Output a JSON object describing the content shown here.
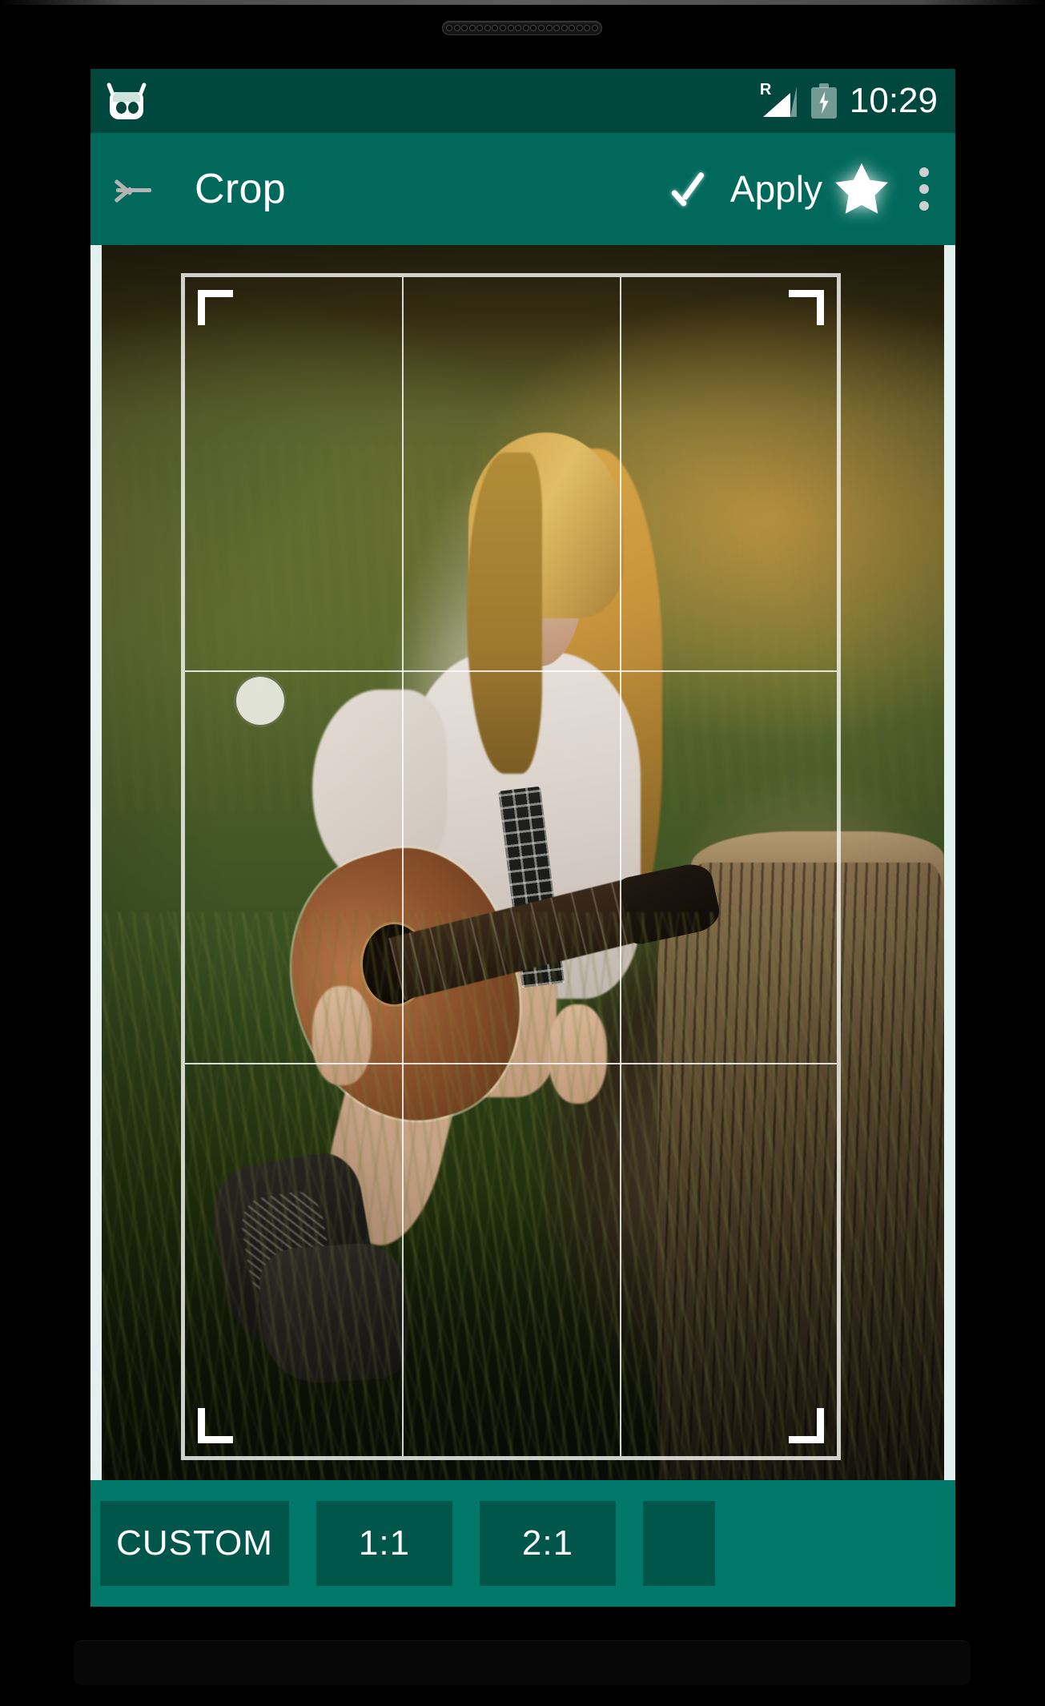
{
  "device": {
    "speaker_holes": 20
  },
  "status_bar": {
    "logo_icon": "cyanogenmod-logo-icon",
    "roaming_indicator": "R",
    "signal_icon": "signal-bars-icon",
    "battery_icon": "battery-charging-icon",
    "time": "10:29",
    "background_color": "#00473d"
  },
  "toolbar": {
    "back_icon": "back-arrow-icon",
    "title": "Crop",
    "check_icon": "check-mark-icon",
    "apply_label": "Apply",
    "star_icon": "star-filled-icon",
    "overflow_icon": "more-vertical-icon",
    "background_color": "#00695c"
  },
  "editor": {
    "canvas_background": "#e2f1ed",
    "photo_description": "Woman with long blonde hair sitting on a tree stump in a sunlit grassy field, playing an acoustic guitar, wearing a white lace dress and black cowboy boots",
    "crop_overlay": {
      "grid": "rule-of-thirds",
      "handles": [
        "top-left",
        "top-right",
        "bottom-left",
        "bottom-right"
      ],
      "touch_indicator": "drag-handle-dot"
    }
  },
  "ratio_bar": {
    "background_color": "#00796b",
    "button_color": "#00564b",
    "options": [
      {
        "label": "CUSTOM",
        "width_class": "w-custom"
      },
      {
        "label": "1:1",
        "width_class": "w-std"
      },
      {
        "label": "2:1",
        "width_class": "w-std"
      },
      {
        "label": "",
        "width_class": "w-cut"
      }
    ]
  }
}
